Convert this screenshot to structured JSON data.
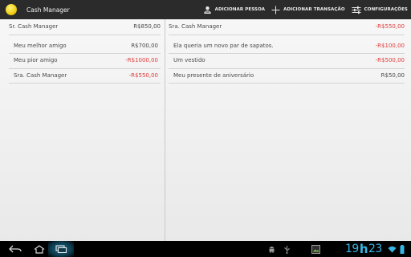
{
  "app": {
    "title": "Cash Manager"
  },
  "actions": {
    "add_person": "ADICIONAR PESSOA",
    "add_transaction": "ADICIONAR TRANSAÇÃO",
    "settings": "CONFIGURAÇÕES"
  },
  "left_pane": {
    "header": {
      "name": "Sr. Cash Manager",
      "amount": "R$850,00"
    },
    "items": [
      {
        "name": "Meu melhor amigo",
        "amount": "R$700,00"
      },
      {
        "name": "Meu pior amigo",
        "amount": "-R$1000,00"
      },
      {
        "name": "Sra. Cash Manager",
        "amount": "-R$550,00"
      }
    ]
  },
  "right_pane": {
    "header": {
      "name": "Sra. Cash Manager",
      "amount": "-R$550,00"
    },
    "items": [
      {
        "name": "Ela queria um novo par de sapatos.",
        "amount": "-R$100,00"
      },
      {
        "name": "Um vestido",
        "amount": "-R$500,00"
      },
      {
        "name": "Meu presente de aniversário",
        "amount": "R$50,00"
      }
    ]
  },
  "status": {
    "hours": "19",
    "minutes": "23",
    "separator": "h"
  },
  "colors": {
    "negative": "#e13b3b",
    "accent": "#36b6e6",
    "logo": "#f3d21a"
  },
  "icons": [
    "back-icon",
    "home-icon",
    "recent-apps-icon",
    "android-debug-icon",
    "usb-icon",
    "gallery-icon",
    "wifi-icon",
    "battery-icon"
  ]
}
